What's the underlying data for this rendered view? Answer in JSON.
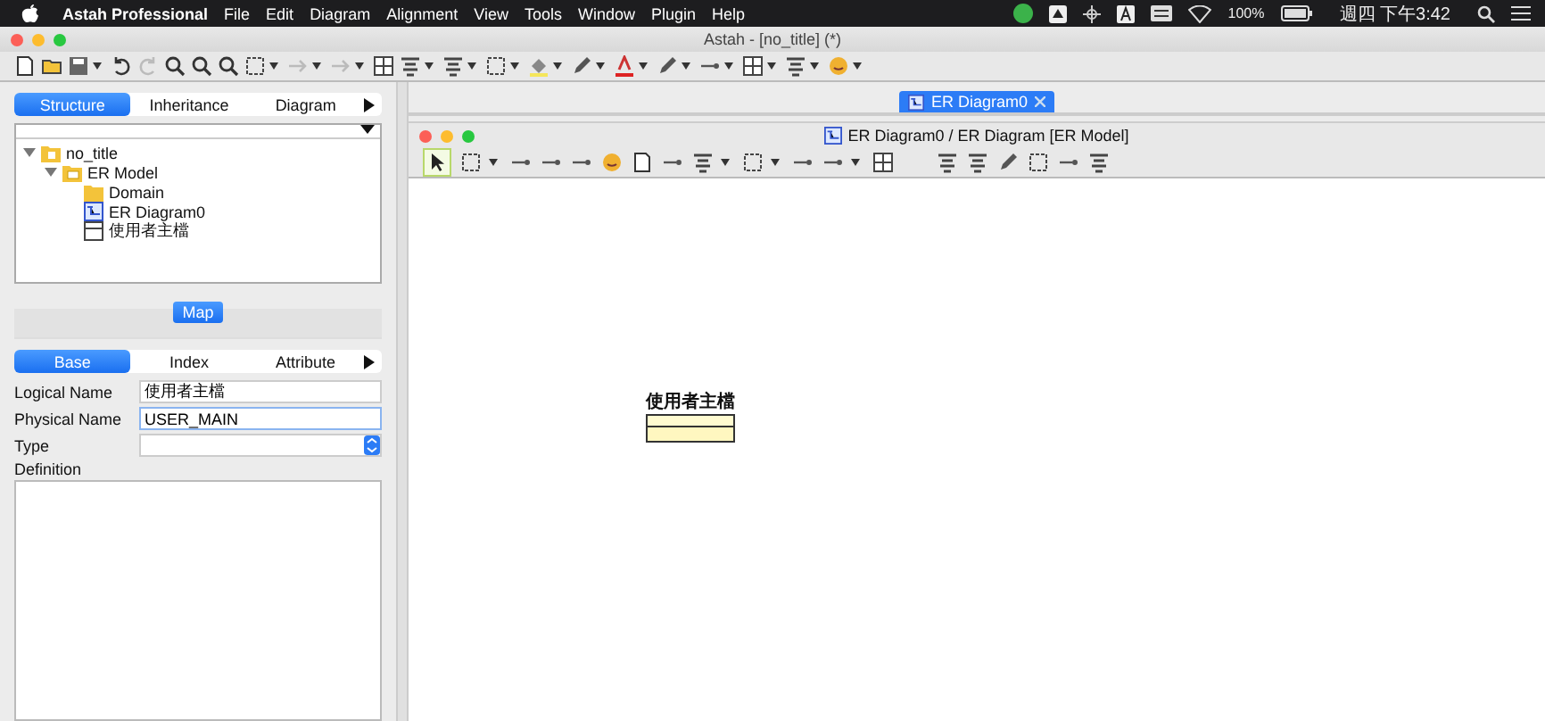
{
  "menu_bar": {
    "app_name": "Astah Professional",
    "menus": [
      "File",
      "Edit",
      "Diagram",
      "Alignment",
      "View",
      "Tools",
      "Window",
      "Plugin",
      "Help"
    ],
    "battery": "100%",
    "clock": "週四 下午3:42"
  },
  "window": {
    "title": "Astah - [no_title] (*)"
  },
  "structure_tabs": [
    {
      "label": "Structure",
      "selected": true
    },
    {
      "label": "Inheritance",
      "selected": false
    },
    {
      "label": "Diagram",
      "selected": false
    }
  ],
  "tree": [
    {
      "label": "no_title",
      "kind": "project",
      "expanded": true,
      "children": [
        {
          "label": "ER Model",
          "kind": "model",
          "expanded": true,
          "children": [
            {
              "label": "Domain",
              "kind": "folder"
            },
            {
              "label": "ER Diagram0",
              "kind": "diagram"
            },
            {
              "label": "使用者主檔",
              "kind": "entity"
            }
          ]
        }
      ]
    }
  ],
  "map_button": "Map",
  "property_tabs": [
    {
      "label": "Base",
      "selected": true
    },
    {
      "label": "Index",
      "selected": false
    },
    {
      "label": "Attribute",
      "selected": false
    }
  ],
  "properties": {
    "logical_name": {
      "label": "Logical Name",
      "value": "使用者主檔"
    },
    "physical_name": {
      "label": "Physical Name",
      "value": "USER_MAIN"
    },
    "type": {
      "label": "Type"
    },
    "definition": {
      "label": "Definition"
    }
  },
  "diagram_tabs": [
    {
      "label": "ER Diagram0",
      "selected": true
    }
  ],
  "diagram_window": {
    "title": "ER Diagram0 / ER Diagram [ER Model]"
  },
  "entity": {
    "name": "使用者主檔"
  }
}
